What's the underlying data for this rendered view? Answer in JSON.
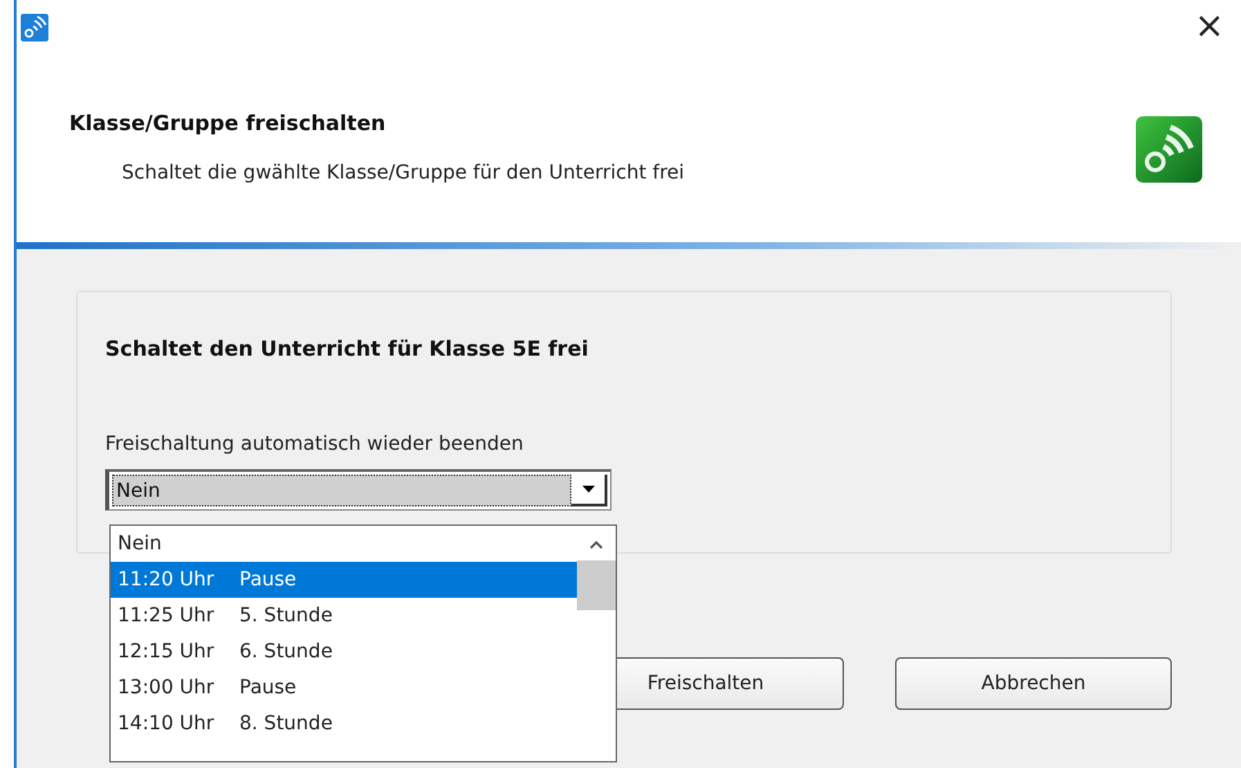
{
  "window": {
    "close": "×"
  },
  "header": {
    "title": "Klasse/Gruppe freischalten",
    "subtitle": "Schaltet die gwählte Klasse/Gruppe für den Unterricht frei"
  },
  "group": {
    "title": "Schaltet den Unterricht für Klasse 5E frei",
    "label": "Freischaltung automatisch wieder beenden"
  },
  "combo": {
    "value": "Nein",
    "expanded": true
  },
  "options": [
    {
      "time": "Nein",
      "selected": false
    },
    {
      "time": "11:20 Uhr",
      "label": "Pause",
      "selected": true
    },
    {
      "time": "11:25 Uhr",
      "label": "5. Stunde",
      "selected": false
    },
    {
      "time": "12:15 Uhr",
      "label": "6. Stunde",
      "selected": false
    },
    {
      "time": "13:00 Uhr",
      "label": "Pause",
      "selected": false
    },
    {
      "time": "14:10 Uhr",
      "label": "8. Stunde",
      "selected": false
    }
  ],
  "buttons": [
    "Freischalten",
    "Abbrechen"
  ]
}
